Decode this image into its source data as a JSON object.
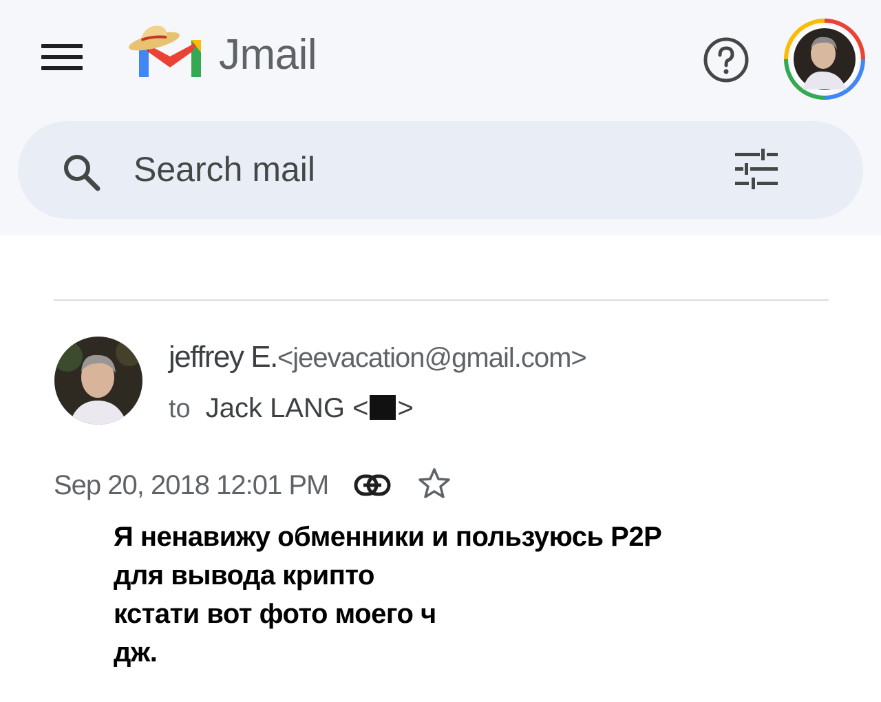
{
  "header": {
    "app_name": "Jmail",
    "logo_icon": "straw-hat-m-logo-icon",
    "menu_icon": "hamburger-menu-icon",
    "help_icon": "help-icon",
    "avatar_icon": "profile-avatar-icon"
  },
  "search": {
    "placeholder": "Search mail",
    "search_icon": "search-icon",
    "filter_icon": "tune-filter-icon"
  },
  "email": {
    "sender_name": "jeffrey E.",
    "sender_email": "<jeevacation@gmail.com>",
    "to_label": "to",
    "recipient_name": "Jack LANG <",
    "recipient_suffix": ">",
    "date": "Sep 20, 2018 12:01 PM",
    "body": [
      "Я ненавижу обменники и пользуюсь P2P",
      "для вывода крипто",
      "кстати вот фото моего ч",
      "дж."
    ]
  },
  "colors": {
    "top_background": "#f6f7fb",
    "search_background": "#e9eef6",
    "text_gray": "#5f6368",
    "google_red": "#ea4335",
    "google_blue": "#4285f4",
    "google_yellow": "#fbbc04",
    "google_green": "#34a853"
  }
}
